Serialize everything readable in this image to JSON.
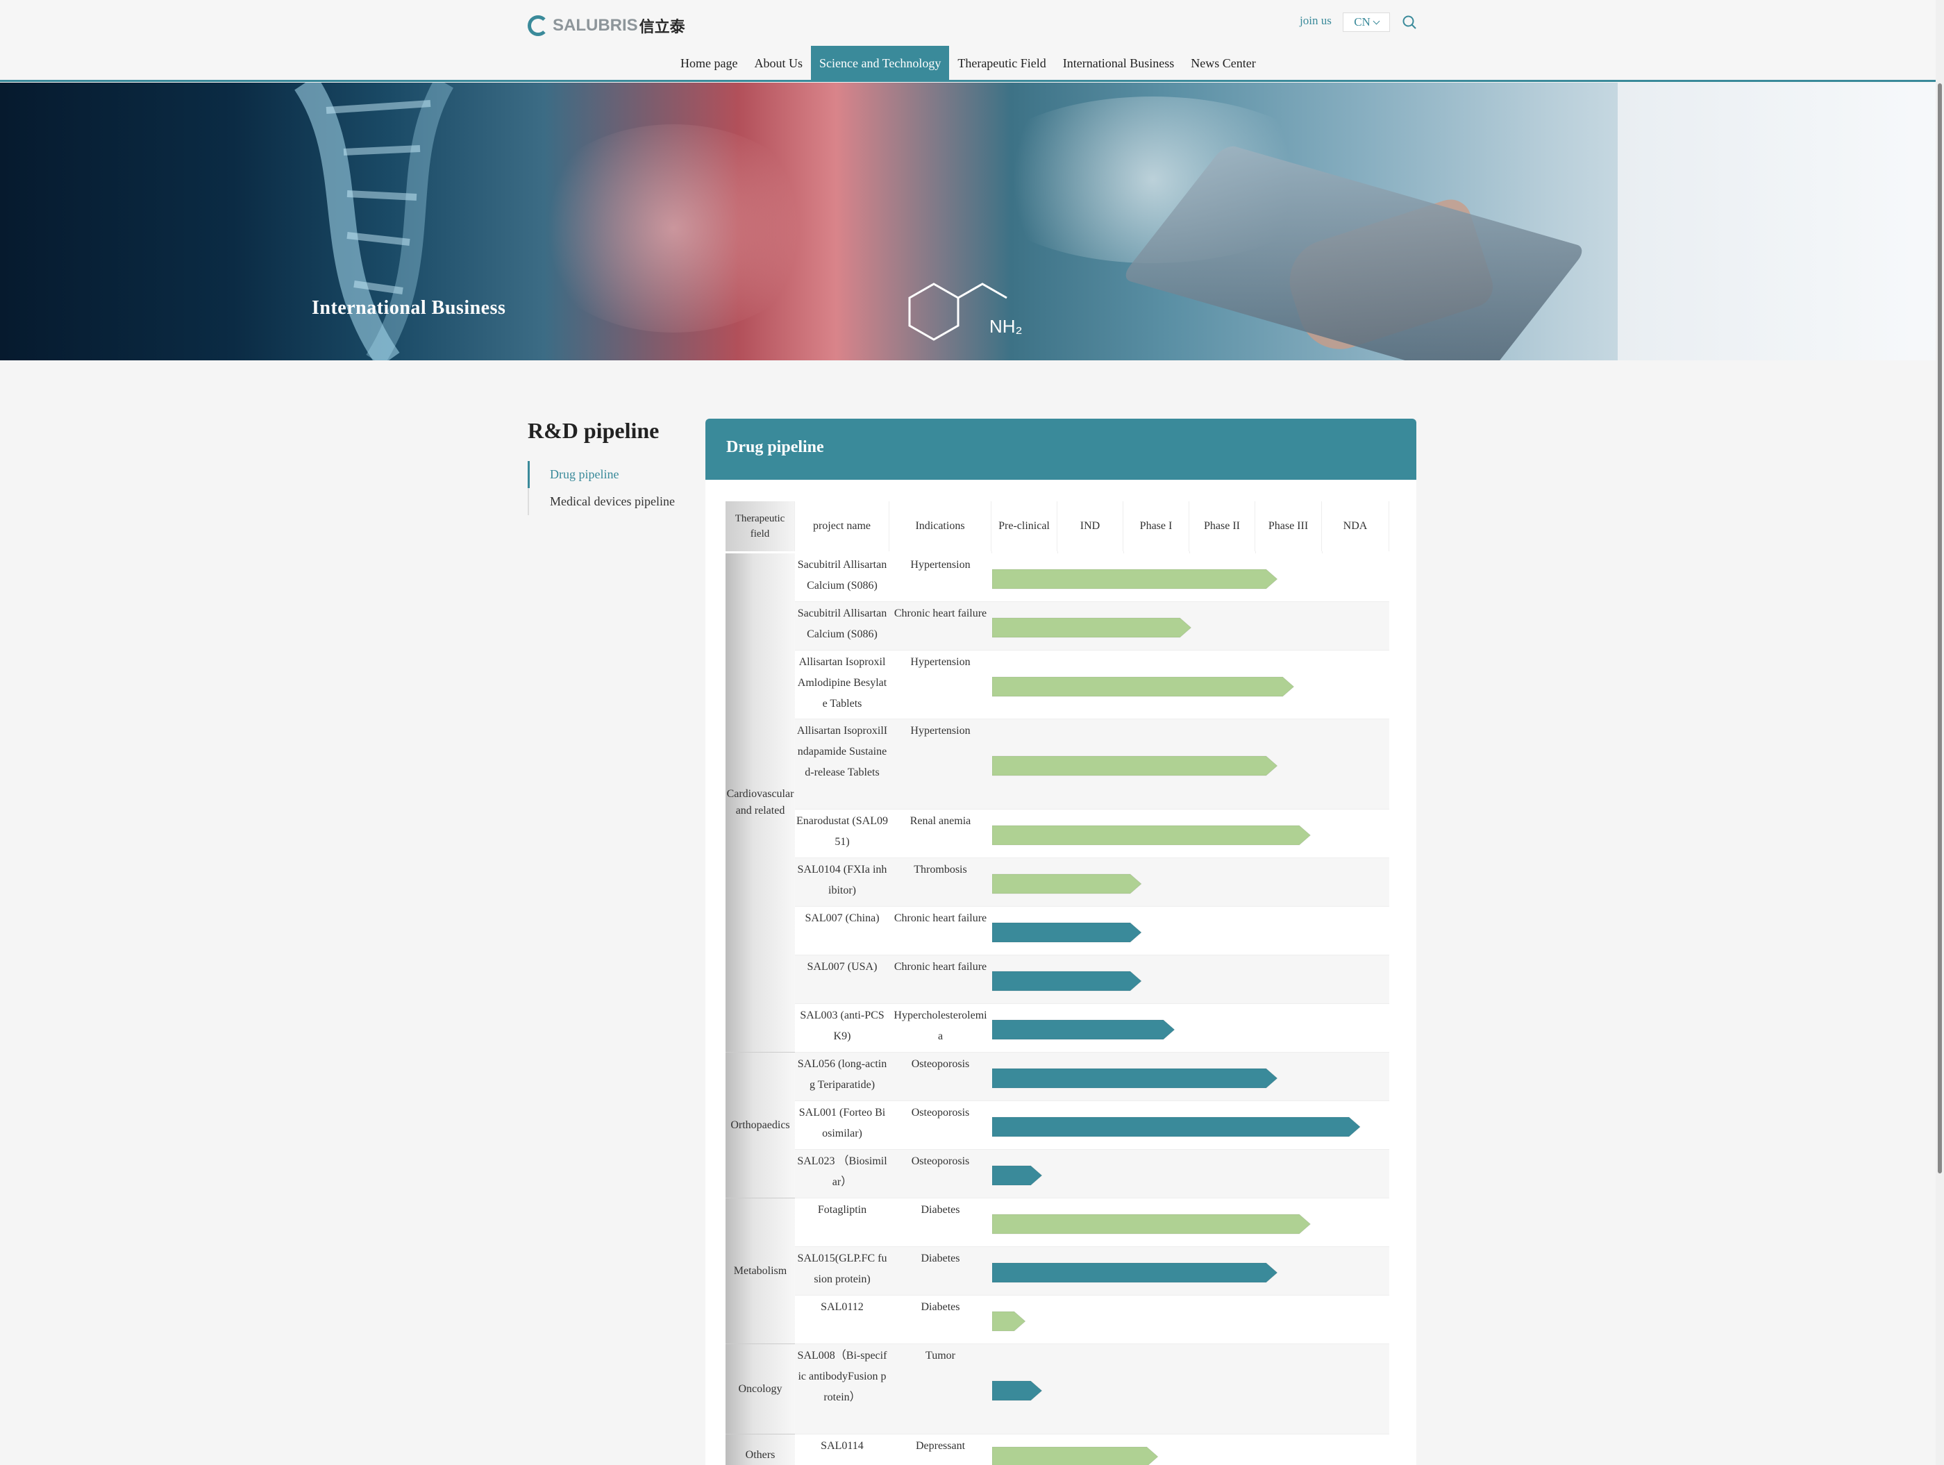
{
  "header": {
    "brand": "SALUBRIS",
    "brand_cn": "信立泰",
    "join_us": "join us",
    "lang": "CN"
  },
  "nav": [
    "Home page",
    "About Us",
    "Science and Technology",
    "Therapeutic Field",
    "International Business",
    "News Center"
  ],
  "nav_active_index": 2,
  "banner": {
    "title": "International Business"
  },
  "sidebar": {
    "title": "R&D pipeline",
    "items": [
      "Drug pipeline",
      "Medical devices pipeline"
    ],
    "active_index": 0
  },
  "panel": {
    "title": "Drug pipeline"
  },
  "colors": {
    "accent": "#3a8a9a",
    "bar_green": "#afd193",
    "bar_teal": "#3a8a9a"
  },
  "table": {
    "headers": [
      "Therapeutic field",
      "project name",
      "Indications",
      "Pre-clinical",
      "IND",
      "Phase I",
      "Phase II",
      "Phase III",
      "NDA"
    ],
    "stages": [
      "Pre-clinical",
      "IND",
      "Phase I",
      "Phase II",
      "Phase III",
      "NDA"
    ],
    "groups": [
      {
        "name": "Cardiovascular and related",
        "rows": [
          0,
          1,
          2,
          3,
          4,
          5,
          6,
          7,
          8
        ]
      },
      {
        "name": "Orthopaedics",
        "rows": [
          9,
          10,
          11
        ]
      },
      {
        "name": "Metabolism",
        "rows": [
          12,
          13,
          14
        ]
      },
      {
        "name": "Oncology",
        "rows": [
          15
        ]
      },
      {
        "name": "Others",
        "rows": [
          16
        ]
      }
    ],
    "rows": [
      {
        "project": "Sacubitril Allisartan Calcium (S086)",
        "indication": "Hypertension",
        "progress_stages": 4.3,
        "color": "green"
      },
      {
        "project": "Sacubitril Allisartan Calcium (S086)",
        "indication": "Chronic heart failure",
        "progress_stages": 3.0,
        "color": "green"
      },
      {
        "project": "Allisartan IsoproxilAmlodipine Besylate Tablets",
        "indication": "Hypertension",
        "progress_stages": 4.55,
        "color": "green"
      },
      {
        "project": "Allisartan IsoproxilIndapamide Sustained-release Tablets",
        "indication": "Hypertension",
        "progress_stages": 4.3,
        "color": "green"
      },
      {
        "project": "Enarodustat (SAL0951)",
        "indication": "Renal anemia",
        "progress_stages": 4.8,
        "color": "green"
      },
      {
        "project": "SAL0104 (FXIa inhibitor)",
        "indication": "Thrombosis",
        "progress_stages": 2.25,
        "color": "green"
      },
      {
        "project": "SAL007 (China)",
        "indication": "Chronic heart failure",
        "progress_stages": 2.25,
        "color": "teal"
      },
      {
        "project": "SAL007 (USA)",
        "indication": "Chronic heart failure",
        "progress_stages": 2.25,
        "color": "teal"
      },
      {
        "project": "SAL003 (anti-PCSK9)",
        "indication": "Hypercholesterolemia",
        "progress_stages": 2.75,
        "color": "teal"
      },
      {
        "project": "SAL056 (long-acting Teriparatide)",
        "indication": "Osteoporosis",
        "progress_stages": 4.3,
        "color": "teal"
      },
      {
        "project": "SAL001 (Forteo Biosimilar)",
        "indication": "Osteoporosis",
        "progress_stages": 5.55,
        "color": "teal"
      },
      {
        "project": "SAL023 （Biosimilar）",
        "indication": "Osteoporosis",
        "progress_stages": 0.75,
        "color": "teal"
      },
      {
        "project": "Fotagliptin",
        "indication": "Diabetes",
        "progress_stages": 4.8,
        "color": "green"
      },
      {
        "project": "SAL015(GLP.FC fusion protein)",
        "indication": "Diabetes",
        "progress_stages": 4.3,
        "color": "teal"
      },
      {
        "project": "SAL0112",
        "indication": "Diabetes",
        "progress_stages": 0.5,
        "color": "green"
      },
      {
        "project": "SAL008（Bi-specific antibodyFusion protein）",
        "indication": "Tumor",
        "progress_stages": 0.75,
        "color": "teal"
      },
      {
        "project": "SAL0114",
        "indication": "Depressant",
        "progress_stages": 2.5,
        "color": "green"
      }
    ]
  }
}
